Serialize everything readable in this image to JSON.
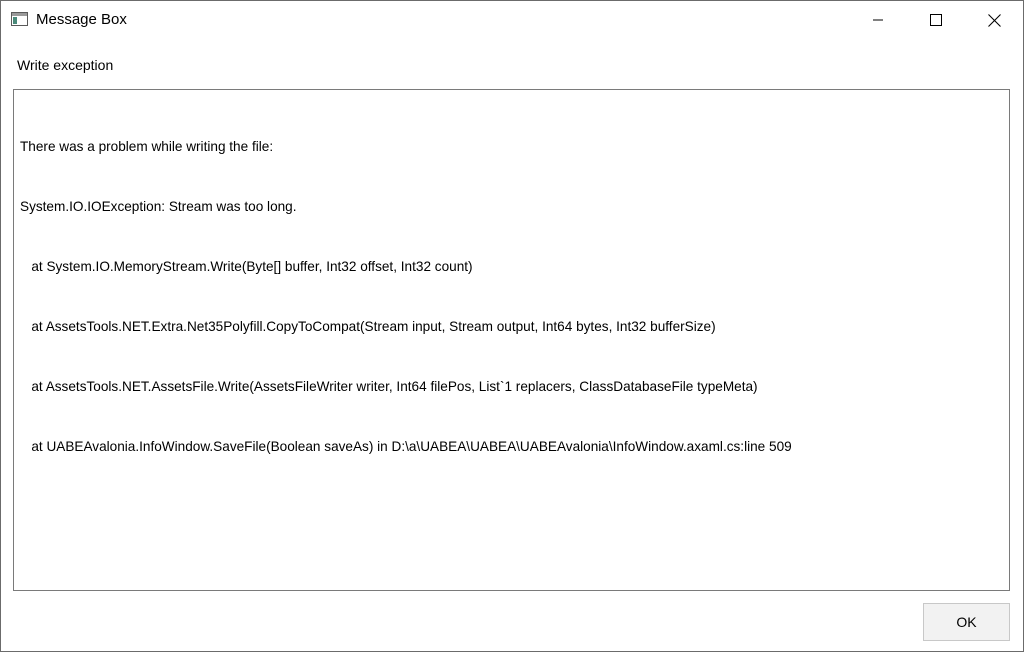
{
  "window": {
    "title": "Message Box",
    "icon": "app-window-icon",
    "controls": [
      "minimize-icon",
      "maximize-icon",
      "close-icon"
    ]
  },
  "message": {
    "header": "Write exception",
    "lines": [
      "There was a problem while writing the file:",
      "System.IO.IOException: Stream was too long.",
      "   at System.IO.MemoryStream.Write(Byte[] buffer, Int32 offset, Int32 count)",
      "   at AssetsTools.NET.Extra.Net35Polyfill.CopyToCompat(Stream input, Stream output, Int64 bytes, Int32 bufferSize)",
      "   at AssetsTools.NET.AssetsFile.Write(AssetsFileWriter writer, Int64 filePos, List`1 replacers, ClassDatabaseFile typeMeta)",
      "   at UABEAvalonia.InfoWindow.SaveFile(Boolean saveAs) in D:\\a\\UABEA\\UABEA\\UABEAvalonia\\InfoWindow.axaml.cs:line 509"
    ]
  },
  "buttons": {
    "ok_label": "OK"
  }
}
